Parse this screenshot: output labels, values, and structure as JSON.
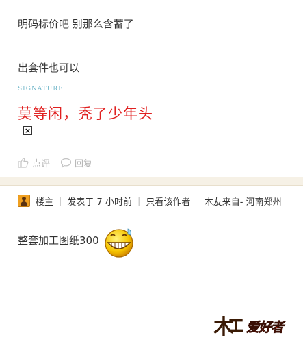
{
  "post1": {
    "line1": "明码标价吧 别那么含蓄了",
    "line2": "出套件也可以",
    "signature_label": "SIGNATURE",
    "signature_text": "莫等闲，秃了少年头",
    "like_label": "点评",
    "reply_label": "回复"
  },
  "post2": {
    "author_role": "楼主",
    "posted_time": "发表于 7 小时前",
    "only_author": "只看该作者",
    "source": "木友来自- 河南郑州",
    "content": "整套加工图纸300"
  },
  "watermark": {
    "char_mu": "木",
    "char_gong": "工",
    "rest": "爱好者"
  },
  "colors": {
    "signature_red": "#e02020",
    "signature_label": "#6fb5c8",
    "muted_gray": "#b5b5b5",
    "band": "#f6f1e6"
  }
}
